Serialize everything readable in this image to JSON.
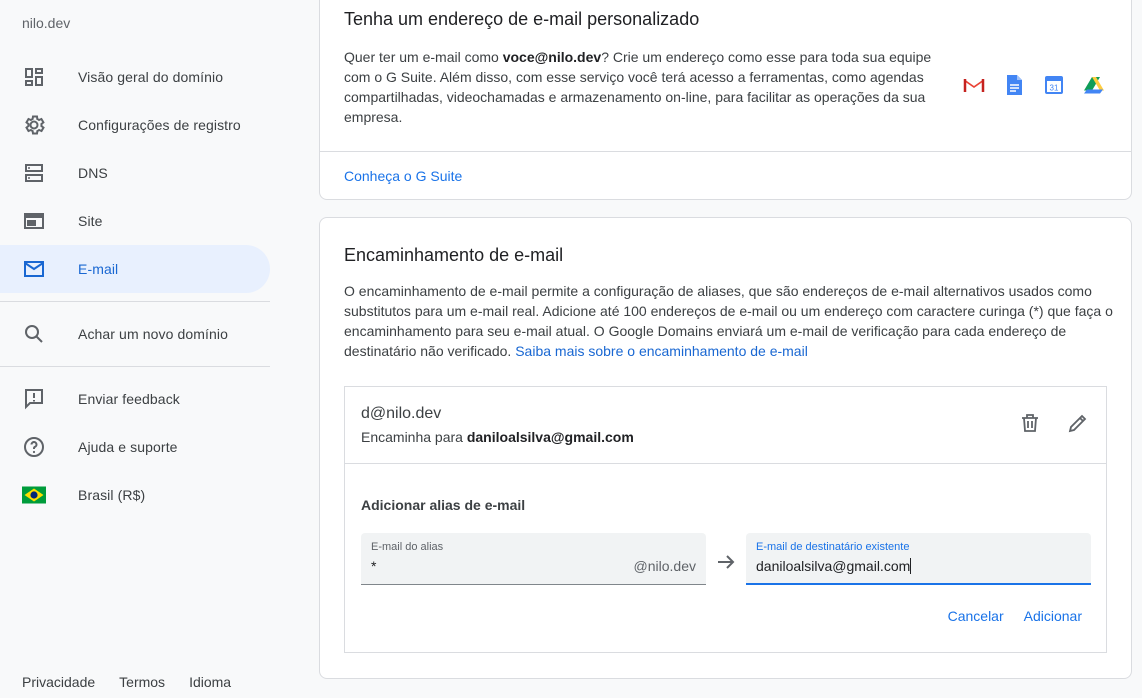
{
  "sidebar": {
    "site_name": "nilo.dev",
    "items": [
      {
        "label": "Visão geral do domínio",
        "icon": "dashboard-icon"
      },
      {
        "label": "Configurações de registro",
        "icon": "gear-icon"
      },
      {
        "label": "DNS",
        "icon": "dns-icon"
      },
      {
        "label": "Site",
        "icon": "website-icon"
      },
      {
        "label": "E-mail",
        "icon": "mail-icon",
        "active": true
      }
    ],
    "search_label": "Achar um novo domínio",
    "support_items": [
      {
        "label": "Enviar feedback",
        "icon": "feedback-icon"
      },
      {
        "label": "Ajuda e suporte",
        "icon": "help-icon"
      },
      {
        "label": "Brasil (R$)",
        "icon": "brazil-flag-icon"
      }
    ],
    "footer": [
      "Privacidade",
      "Termos",
      "Idioma"
    ]
  },
  "gsuite_card": {
    "title": "Tenha um endereço de e-mail personalizado",
    "desc_prefix": "Quer ter um e-mail como ",
    "desc_bold": "voce@nilo.dev",
    "desc_suffix": "? Crie um endereço como esse para toda sua equipe com o G Suite. Além disso, com esse serviço você terá acesso a ferramentas, como agendas compartilhadas, videochamadas e armazenamento on-line, para facilitar as operações da sua empresa.",
    "apps": [
      "gmail-icon",
      "docs-icon",
      "calendar-icon",
      "drive-icon"
    ],
    "calendar_day": "31",
    "link": "Conheça o G Suite"
  },
  "forwarding_card": {
    "title": "Encaminhamento de e-mail",
    "desc": "O encaminhamento de e-mail permite a configuração de aliases, que são endereços de e-mail alternativos usados como substitutos para um e-mail real. Adicione até 100 endereços de e-mail ou um endereço com caractere curinga (*) que faça o encaminhamento para seu e-mail atual. O Google Domains enviará um e-mail de verificação para cada endereço de destinatário não verificado. ",
    "desc_link": "Saiba mais sobre o encaminhamento de e-mail",
    "alias": "d@nilo.dev",
    "forward_prefix": "Encaminha para ",
    "forward_target": "daniloalsilva@gmail.com",
    "add_title": "Adicionar alias de e-mail",
    "alias_field": {
      "label": "E-mail do alias",
      "value": "*",
      "suffix": "@nilo.dev"
    },
    "recipient_field": {
      "label": "E-mail de destinatário existente",
      "value": "daniloalsilva@gmail.com"
    },
    "cancel": "Cancelar",
    "add": "Adicionar"
  },
  "colors": {
    "accent": "#1a73e8",
    "active_bg": "#e8f0fe"
  }
}
